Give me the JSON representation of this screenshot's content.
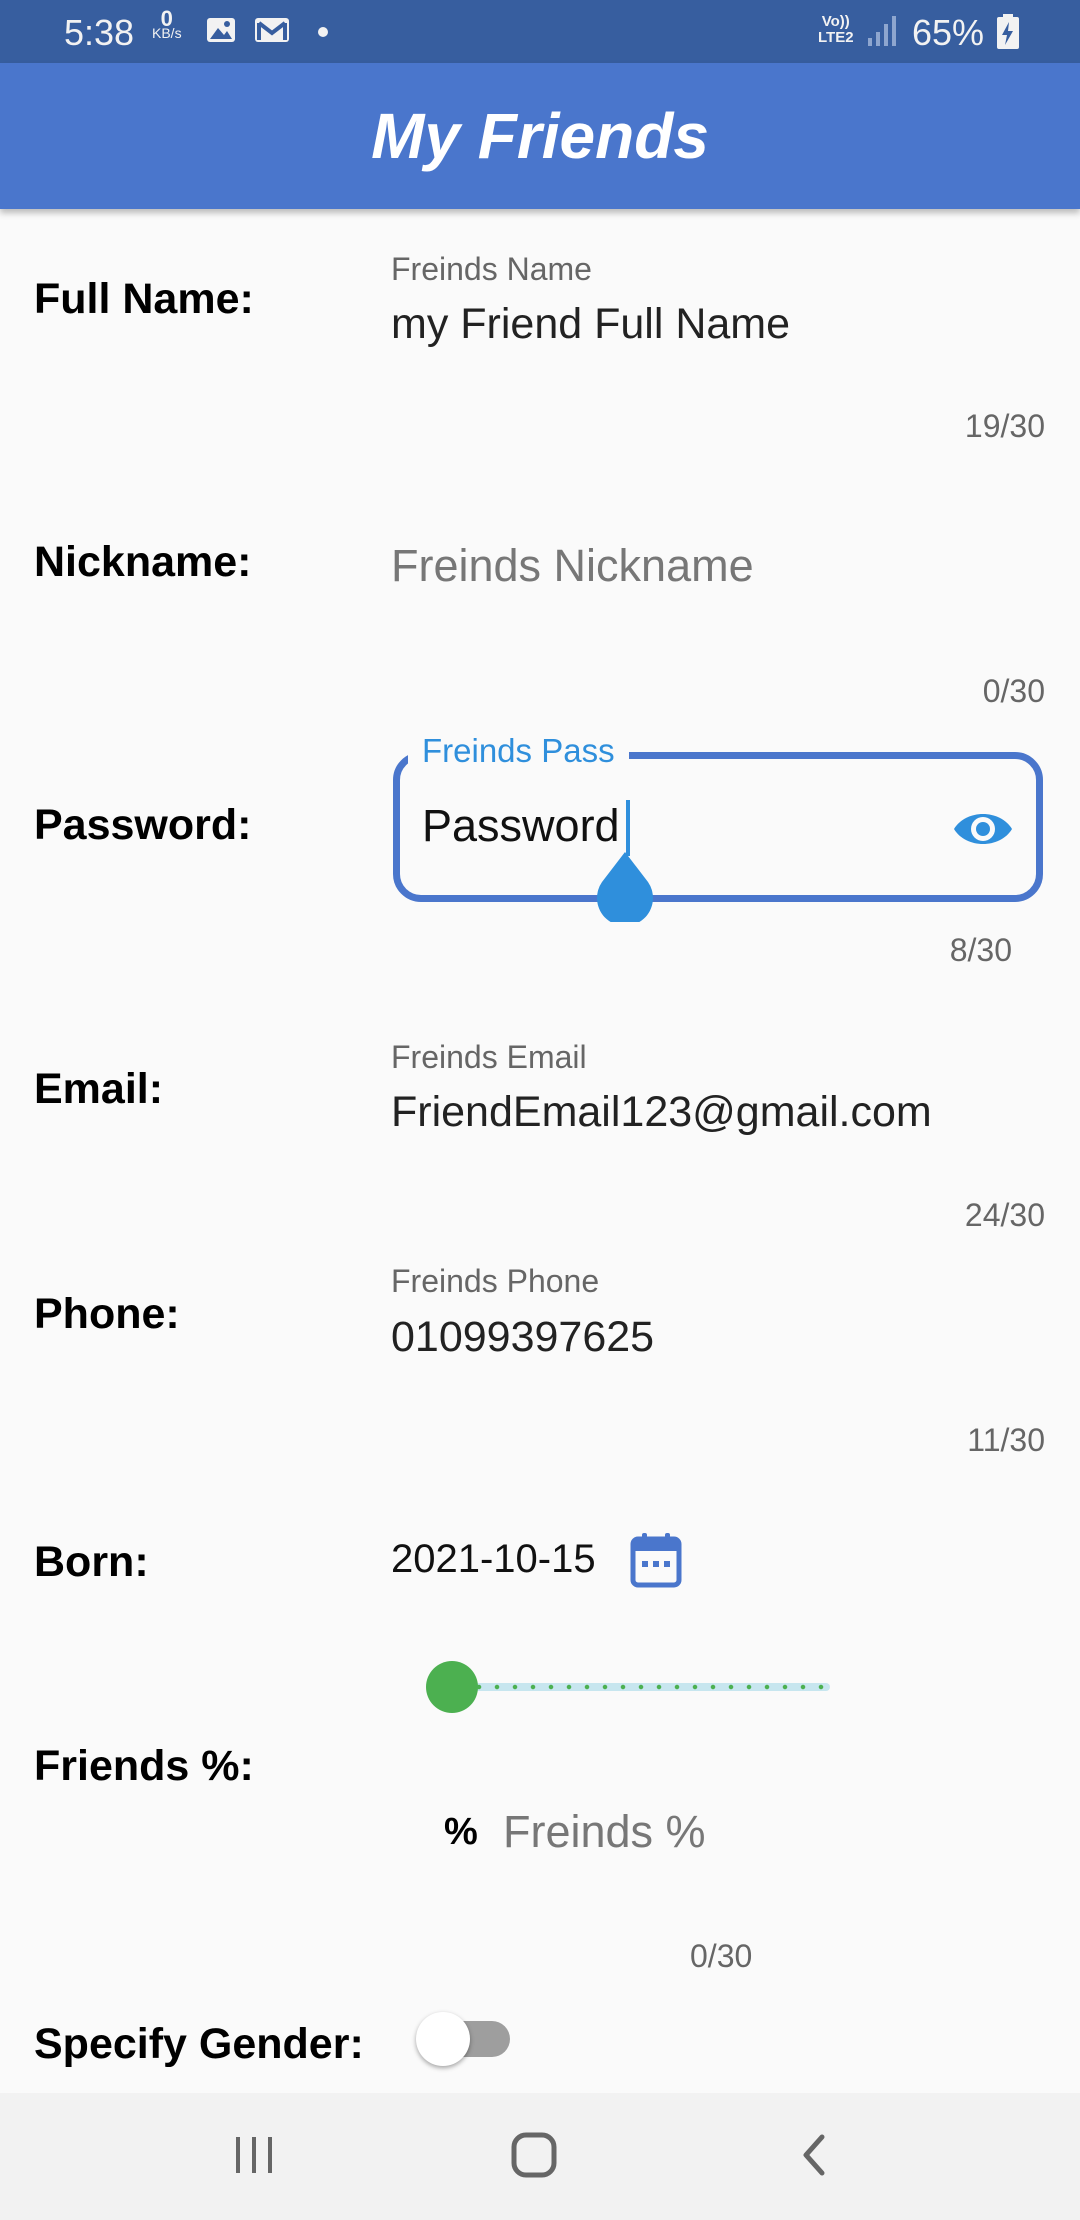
{
  "status_bar": {
    "time": "5:38",
    "net_speed_value": "0",
    "net_speed_unit": "KB/s",
    "volte_line1": "Vo))",
    "volte_line2": "LTE2",
    "battery_percent": "65%",
    "icons": [
      "image-icon",
      "gmail-icon",
      "notification-dot",
      "signal-icon",
      "battery-charging-icon"
    ]
  },
  "app_bar": {
    "title": "My Friends"
  },
  "form": {
    "full_name": {
      "label": "Full Name:",
      "float_label": "Freinds Name",
      "value": "my Friend Full Name",
      "counter": "19/30"
    },
    "nickname": {
      "label": "Nickname:",
      "placeholder": "Freinds Nickname",
      "counter": "0/30"
    },
    "password": {
      "label": "Password:",
      "float_label": "Freinds Pass",
      "value": "Password",
      "counter": "8/30",
      "icon": "eye-icon"
    },
    "email": {
      "label": "Email:",
      "float_label": "Freinds Email",
      "value": "FriendEmail123@gmail.com",
      "counter": "24/30"
    },
    "phone": {
      "label": "Phone:",
      "float_label": "Freinds Phone",
      "value": "01099397625",
      "counter": "11/30"
    },
    "born": {
      "label": "Born:",
      "value": "2021-10-15",
      "icon": "calendar-icon"
    },
    "friends_percent": {
      "label": "Friends %:",
      "slider_value": 0,
      "prefix": "%",
      "placeholder": "Freinds %",
      "counter": "0/30"
    },
    "gender": {
      "label": "Specify Gender:",
      "toggle_on": false
    }
  },
  "colors": {
    "status_bar": "#375e9f",
    "app_bar": "#4a76cc",
    "focus_border": "#4a76cc",
    "accent_blue": "#2f8fdc",
    "slider_green": "#4cb050"
  },
  "nav_bar": {
    "buttons": [
      "recent-apps-icon",
      "home-icon",
      "back-icon"
    ]
  }
}
